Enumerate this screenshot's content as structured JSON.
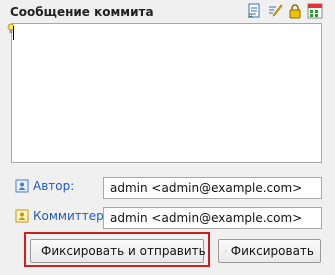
{
  "header": {
    "title": "Сообщение коммита",
    "toolbar_icons": [
      "format-icon",
      "pencil-icon",
      "lock-icon",
      "grid-icon"
    ]
  },
  "message": {
    "value": ""
  },
  "author": {
    "label": "Автор:",
    "value": "admin <admin@example.com>"
  },
  "committer": {
    "label": "Коммиттер:",
    "value": "admin <admin@example.com>"
  },
  "actions": {
    "commit_push_label": "Фиксировать и отправить",
    "commit_label": "Фиксировать"
  },
  "colors": {
    "label_blue": "#1e5bbf",
    "highlight_red": "#d11d1d"
  }
}
